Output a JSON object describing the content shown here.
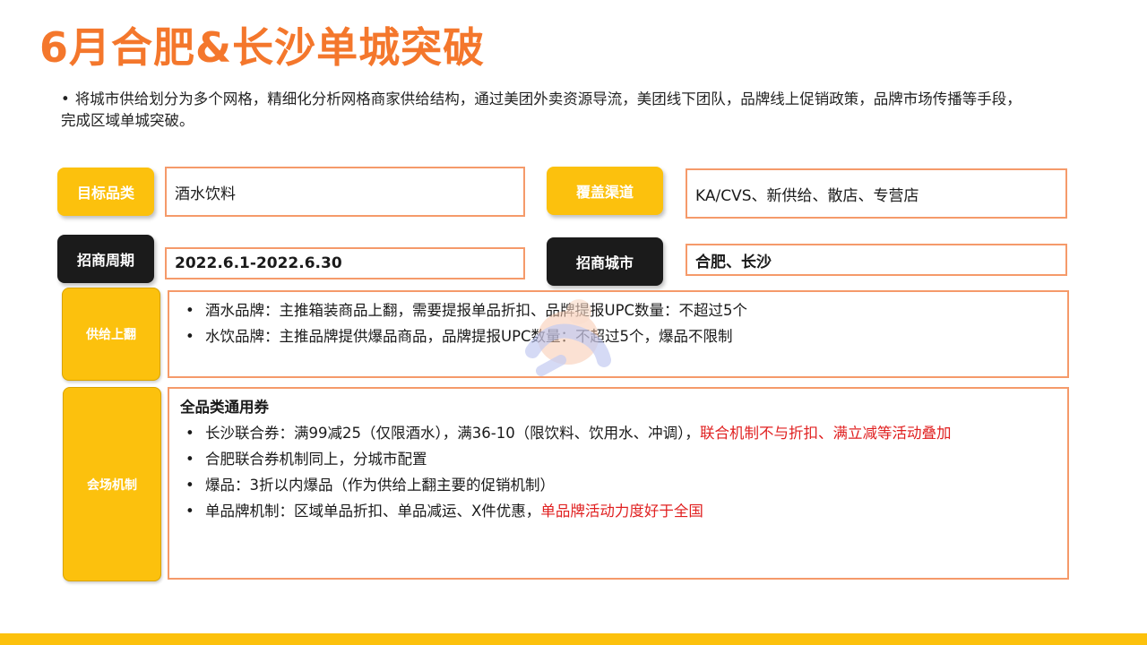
{
  "title": "6月合肥&长沙单城突破",
  "intro": {
    "bullet": "•",
    "text": "将城市供给划分为多个网格，精细化分析网格商家供给结构，通过美团外卖资源导流，美团线下团队，品牌线上促销政策，品牌市场传播等手段，完成区域单城突破。"
  },
  "fields": {
    "target_category": {
      "label": "目标品类",
      "value": "酒水饮料"
    },
    "channels": {
      "label": "覆盖渠道",
      "value": "KA/CVS、新供给、散店、专营店"
    },
    "period": {
      "label": "招商周期",
      "value": "2022.6.1-2022.6.30"
    },
    "cities": {
      "label": "招商城市",
      "value": "合肥、长沙"
    }
  },
  "supply": {
    "label": "供给上翻",
    "items": [
      "酒水品牌：主推箱装商品上翻，需要提报单品折扣、品牌提报UPC数量：不超过5个",
      "水饮品牌：主推品牌提供爆品商品，品牌提报UPC数量：不超过5个，爆品不限制"
    ]
  },
  "venue": {
    "label": "会场机制",
    "heading": "全品类通用券",
    "items": [
      {
        "text": "长沙联合券：满99减25（仅限酒水），满36-10（限饮料、饮用水、冲调），",
        "highlight": "联合机制不与折扣、满立减等活动叠加"
      },
      {
        "text": "合肥联合券机制同上，分城市配置",
        "highlight": ""
      },
      {
        "text": "爆品：3折以内爆品（作为供给上翻主要的促销机制）",
        "highlight": ""
      },
      {
        "text": "单品牌机制：区域单品折扣、单品减运、X件优惠，",
        "highlight": "单品牌活动力度好于全国"
      }
    ]
  },
  "colors": {
    "title": "#f4772c",
    "label_yellow": "#fcc10d",
    "label_dark": "#1b1b1b",
    "border": "#f59a6a",
    "highlight": "#e02020"
  },
  "bullet": "•"
}
